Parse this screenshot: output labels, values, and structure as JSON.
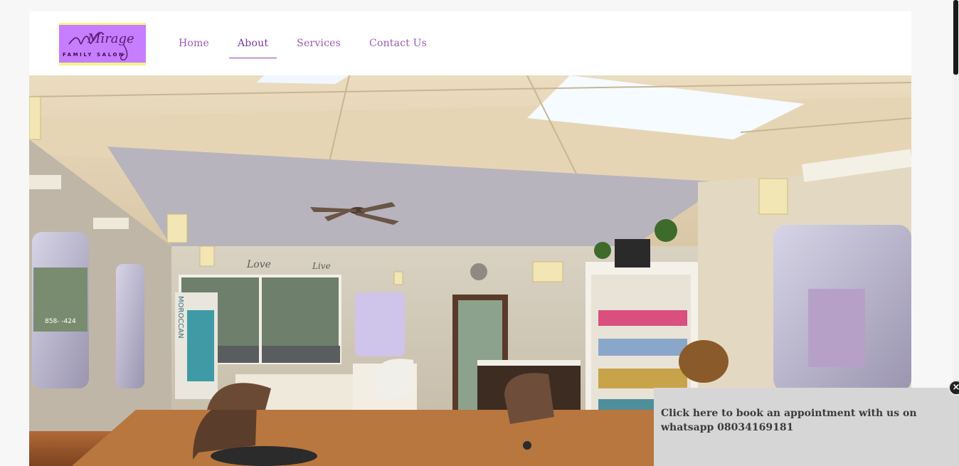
{
  "logo": {
    "script_text": "Mirage",
    "subtitle": "FAMILY SALON",
    "colors": {
      "background": "#c77dff",
      "stripe": "#f5f58a",
      "ink": "#5b1a6e"
    }
  },
  "nav": {
    "items": [
      {
        "label": "Home",
        "active": false
      },
      {
        "label": "About",
        "active": true
      },
      {
        "label": "Services",
        "active": false
      },
      {
        "label": "Contact Us",
        "active": false
      }
    ],
    "color": "#9b59b6"
  },
  "hero": {
    "window_sign": "858-   -424",
    "wall_words": [
      "Love",
      "Live"
    ],
    "product_sign": "MOROCCAN"
  },
  "popup": {
    "text": "Click here to book an appointment with us on whatsapp 08034169181",
    "close_icon": "close-icon"
  }
}
